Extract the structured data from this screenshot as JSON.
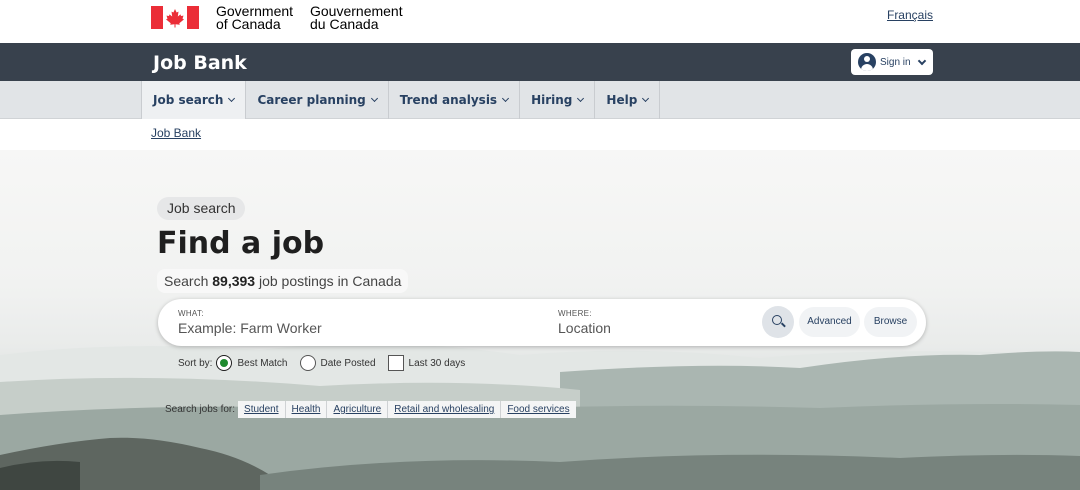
{
  "header": {
    "signature_en_line1": "Government",
    "signature_en_line2": "of Canada",
    "signature_fr_line1": "Gouvernement",
    "signature_fr_line2": "du Canada",
    "language_link": "Français",
    "flag_icon": "canada-flag-icon"
  },
  "app_bar": {
    "title": "Job Bank",
    "signin_label": "Sign in",
    "colors": {
      "bar": "#38414d",
      "link": "#284162"
    }
  },
  "menu": {
    "items": [
      {
        "label": "Job search"
      },
      {
        "label": "Career planning"
      },
      {
        "label": "Trend analysis"
      },
      {
        "label": "Hiring"
      },
      {
        "label": "Help"
      }
    ]
  },
  "breadcrumb": {
    "label": "Job Bank"
  },
  "hero": {
    "pill": "Job search",
    "heading": "Find a job",
    "count_prefix": "Search ",
    "count": "89,393",
    "count_suffix": " job postings in Canada",
    "search": {
      "what_label": "WHAT:",
      "what_placeholder": "Example: Farm Worker",
      "where_label": "WHERE:",
      "where_placeholder": "Location",
      "advanced_label": "Advanced",
      "browse_label": "Browse"
    },
    "sort": {
      "label": "Sort by:",
      "options": [
        {
          "label": "Best Match",
          "selected": true
        },
        {
          "label": "Date Posted",
          "selected": false
        }
      ],
      "last30_label": "Last 30 days",
      "last30_checked": false
    },
    "quick": {
      "label": "Search jobs for:",
      "links": [
        "Student",
        "Health",
        "Agriculture",
        "Retail and wholesaling",
        "Food services"
      ]
    }
  }
}
